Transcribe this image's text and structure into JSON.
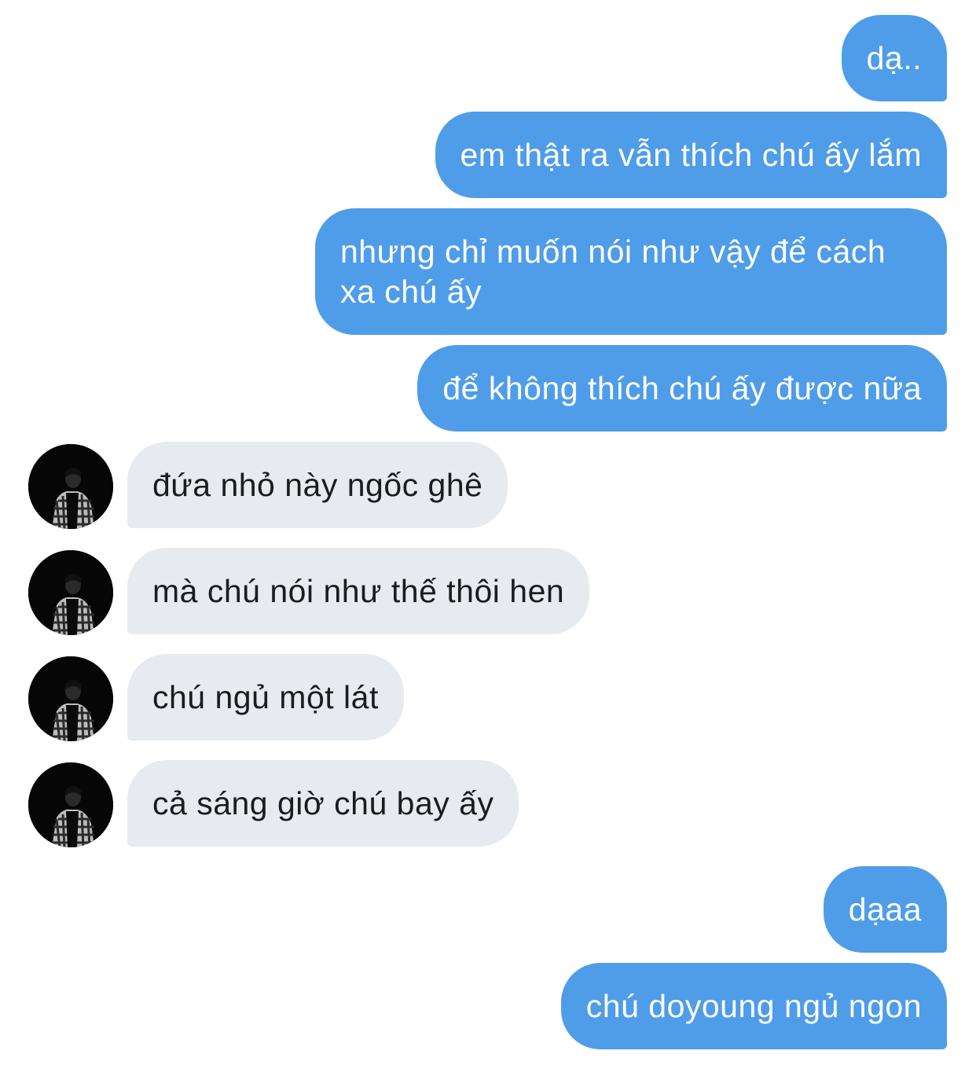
{
  "conversation": {
    "messages": [
      {
        "side": "sent",
        "text": "dạ.."
      },
      {
        "side": "sent",
        "text": "em thật ra vẫn thích chú ấy lắm"
      },
      {
        "side": "sent",
        "text": "nhưng chỉ muốn nói như vậy để cách xa chú ấy"
      },
      {
        "side": "sent",
        "text": "để không thích chú ấy được nữa"
      },
      {
        "side": "received",
        "text": "đứa nhỏ này ngốc ghê"
      },
      {
        "side": "received",
        "text": "mà chú nói như thế thôi hen"
      },
      {
        "side": "received",
        "text": "chú ngủ một lát"
      },
      {
        "side": "received",
        "text": "cả sáng giờ chú bay ấy"
      },
      {
        "side": "sent",
        "text": "dạaa"
      },
      {
        "side": "sent",
        "text": "chú doyoung ngủ ngon"
      }
    ]
  },
  "colors": {
    "sent_bubble": "#4f9de8",
    "received_bubble": "#e7eaef",
    "background": "#ffffff"
  },
  "icons": {
    "avatar": "profile-photo-avatar"
  }
}
